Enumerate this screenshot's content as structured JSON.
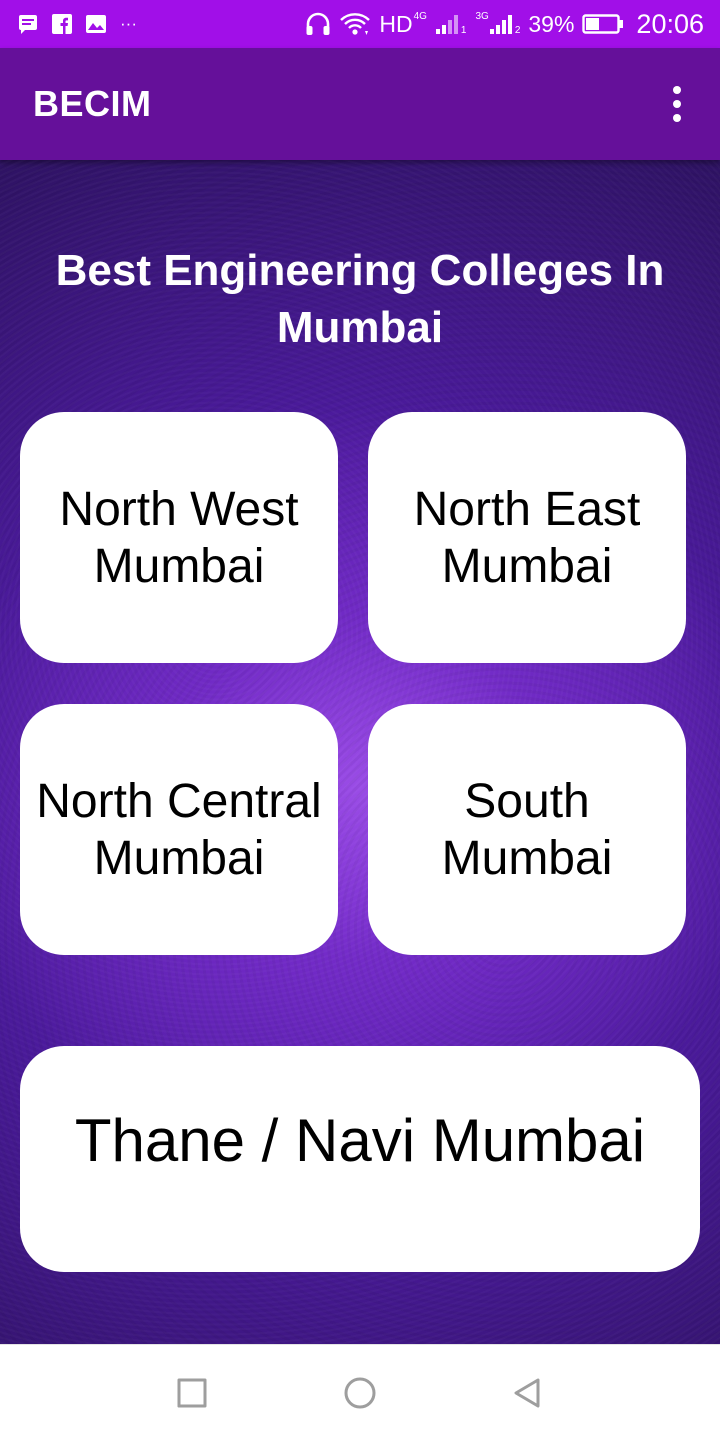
{
  "status_bar": {
    "network_label": "HD",
    "network_4g": "4G",
    "signal1_sub": "1",
    "network_3g": "3G",
    "signal2_sub": "2",
    "battery_percent": "39%",
    "time": "20:06",
    "overflow_notifications": "···",
    "icons": [
      "message-icon",
      "facebook-icon",
      "image-icon",
      "headphones-icon",
      "wifi-icon",
      "signal-icon",
      "battery-icon"
    ],
    "color": "#a10fe8"
  },
  "app_bar": {
    "title": "BECIM",
    "color": "#65109a",
    "menu_icon": "more-vertical-icon"
  },
  "main": {
    "heading": "Best Engineering Colleges In Mumbai",
    "tiles": [
      {
        "line1": "North West",
        "line2": "Mumbai"
      },
      {
        "line1": "North East",
        "line2": "Mumbai"
      },
      {
        "line1": "North Central",
        "line2": "Mumbai"
      },
      {
        "line1": "South",
        "line2": "Mumbai"
      },
      {
        "label": "Thane / Navi Mumbai"
      }
    ]
  },
  "nav_bar": {
    "icons": [
      "recents-icon",
      "home-icon",
      "back-icon"
    ]
  }
}
